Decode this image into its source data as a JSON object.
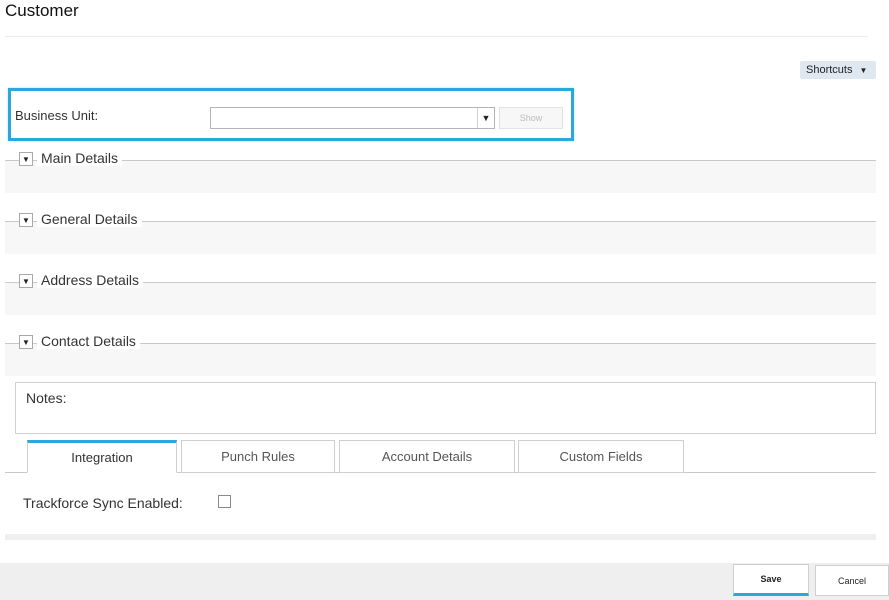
{
  "page": {
    "title": "Customer"
  },
  "shortcuts": {
    "label": "Shortcuts"
  },
  "business_unit": {
    "label": "Business Unit:",
    "value": "",
    "show_label": "Show"
  },
  "sections": [
    {
      "label": "Main Details"
    },
    {
      "label": "General Details"
    },
    {
      "label": "Address Details"
    },
    {
      "label": "Contact Details"
    }
  ],
  "notes": {
    "label": "Notes:"
  },
  "tabs": [
    {
      "label": "Integration",
      "active": true
    },
    {
      "label": "Punch Rules"
    },
    {
      "label": "Account Details"
    },
    {
      "label": "Custom Fields"
    }
  ],
  "integration": {
    "sync_label": "Trackforce Sync Enabled:",
    "sync_checked": false
  },
  "footer": {
    "save_label": "Save",
    "cancel_label": "Cancel"
  },
  "colors": {
    "accent": "#29a8dd",
    "shortcuts_bg": "#dfe7f1",
    "section_band": "#f7f7f7"
  }
}
